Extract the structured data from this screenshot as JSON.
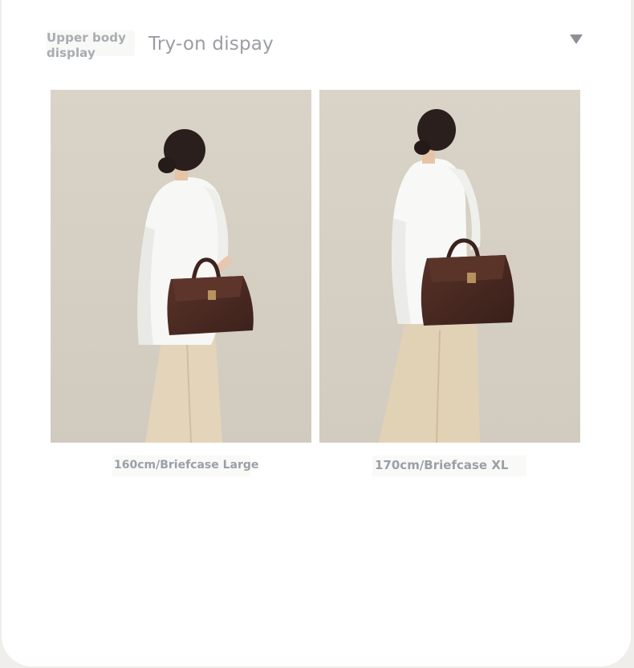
{
  "header": {
    "label": "Upper body\ndisplay",
    "title": "Try-on dispay",
    "dropdown_icon": "triangle-down-icon"
  },
  "gallery": [
    {
      "caption": "160cm/Briefcase Large",
      "image": "model-back-view-with-brown-leather-briefcase"
    },
    {
      "caption": "170cm/Briefcase XL",
      "image": "model-back-view-with-brown-leather-briefcase-xl"
    }
  ],
  "colors": {
    "background": "#efeeea",
    "card": "#ffffff",
    "label_text": "#a9acb0",
    "caption_text": "#9aa0a6",
    "photo_backdrop": "#d8d3c9",
    "bag_brown": "#4a2a22",
    "pants_beige": "#e2d2b6"
  }
}
